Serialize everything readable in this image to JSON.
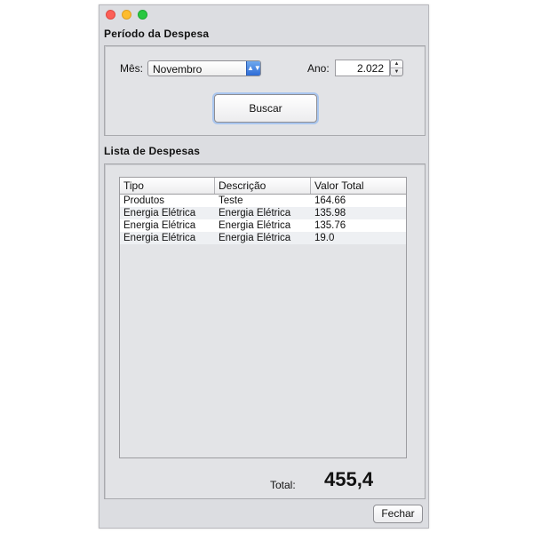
{
  "window": {
    "controls": [
      "close",
      "minimize",
      "maximize"
    ]
  },
  "periodo": {
    "title": "Período da Despesa",
    "mes_label": "Mês:",
    "mes_value": "Novembro",
    "ano_label": "Ano:",
    "ano_value": "2.022",
    "buscar_label": "Buscar"
  },
  "lista": {
    "title": "Lista de Despesas",
    "columns": [
      "Tipo",
      "Descrição",
      "Valor Total"
    ],
    "rows": [
      [
        "Produtos",
        "Teste",
        "164.66"
      ],
      [
        "Energia Elétrica",
        "Energia Elétrica",
        "135.98"
      ],
      [
        "Energia Elétrica",
        "Energia Elétrica",
        "135.76"
      ],
      [
        "Energia Elétrica",
        "Energia Elétrica",
        "19.0"
      ]
    ]
  },
  "total": {
    "label": "Total:",
    "value": "455,4"
  },
  "footer": {
    "fechar_label": "Fechar"
  }
}
